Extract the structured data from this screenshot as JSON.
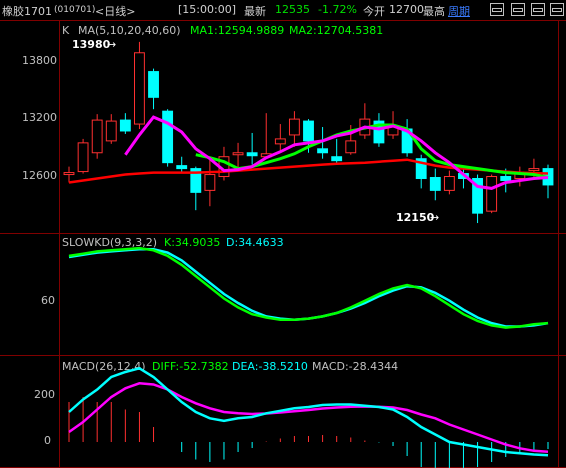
{
  "header": {
    "name": "橡胶1701",
    "code": "(010701)",
    "period": "<日线>",
    "time": "[15:00:00]",
    "latest_label": "最新",
    "latest": "12535",
    "change": "-1.72%",
    "open_label": "今开",
    "open": "12700",
    "high_label": "最高",
    "period_link": "周期"
  },
  "colors": {
    "up": "#ff3030",
    "down": "#00ffff",
    "ma1": "#ff00ff",
    "ma2": "#00ff00",
    "ma3": "#ff0000",
    "frame": "#800000",
    "text": "#c0c0c0"
  },
  "kline": {
    "legend_k": "K",
    "legend_ma": "MA(5,10,20,40,60)",
    "ma1_text": "MA1:12594.9889",
    "ma2_text": "MA2:12704.5381",
    "yticks": [
      "13800",
      "13200",
      "12600"
    ],
    "high_label": "13980",
    "low_label": "12150"
  },
  "slowkd": {
    "legend": "SLOWKD(9,3,3,2)",
    "k_text": "K:34.9035",
    "d_text": "D:34.4633",
    "yticks": [
      "60"
    ]
  },
  "macd": {
    "legend": "MACD(26,12,4)",
    "diff_text": "DIFF:-52.7382",
    "dea_text": "DEA:-38.5210",
    "macd_text": "MACD:-28.4344",
    "yticks": [
      "200",
      "0"
    ]
  },
  "chart_data": {
    "type": "candlestick",
    "candles": [
      {
        "o": 12640,
        "c": 12660,
        "h": 12720,
        "l": 12560
      },
      {
        "o": 12670,
        "c": 12960,
        "h": 13000,
        "l": 12650
      },
      {
        "o": 12860,
        "c": 13190,
        "h": 13250,
        "l": 12800
      },
      {
        "o": 12980,
        "c": 13180,
        "h": 13250,
        "l": 12950
      },
      {
        "o": 13190,
        "c": 13080,
        "h": 13260,
        "l": 13050
      },
      {
        "o": 13150,
        "c": 13870,
        "h": 13980,
        "l": 13100
      },
      {
        "o": 13680,
        "c": 13420,
        "h": 13710,
        "l": 13300
      },
      {
        "o": 13280,
        "c": 12760,
        "h": 13300,
        "l": 12720
      },
      {
        "o": 12730,
        "c": 12700,
        "h": 12820,
        "l": 12660
      },
      {
        "o": 12700,
        "c": 12460,
        "h": 12720,
        "l": 12280
      },
      {
        "o": 12480,
        "c": 12640,
        "h": 12800,
        "l": 12320
      },
      {
        "o": 12620,
        "c": 12820,
        "h": 12920,
        "l": 12580
      },
      {
        "o": 12840,
        "c": 12860,
        "h": 12960,
        "l": 12700
      },
      {
        "o": 12860,
        "c": 12830,
        "h": 13060,
        "l": 12740
      },
      {
        "o": 12820,
        "c": 12850,
        "h": 13260,
        "l": 12800
      },
      {
        "o": 12950,
        "c": 13000,
        "h": 13150,
        "l": 12880
      },
      {
        "o": 13040,
        "c": 13200,
        "h": 13280,
        "l": 12920
      },
      {
        "o": 13180,
        "c": 12980,
        "h": 13200,
        "l": 12860
      },
      {
        "o": 12900,
        "c": 12860,
        "h": 13120,
        "l": 12800
      },
      {
        "o": 12820,
        "c": 12780,
        "h": 13000,
        "l": 12740
      },
      {
        "o": 12860,
        "c": 12980,
        "h": 13140,
        "l": 12840
      },
      {
        "o": 13040,
        "c": 13200,
        "h": 13360,
        "l": 13000
      },
      {
        "o": 13180,
        "c": 12960,
        "h": 13260,
        "l": 12920
      },
      {
        "o": 13040,
        "c": 13120,
        "h": 13280,
        "l": 13000
      },
      {
        "o": 13100,
        "c": 12860,
        "h": 13200,
        "l": 12820
      },
      {
        "o": 12800,
        "c": 12600,
        "h": 12840,
        "l": 12500
      },
      {
        "o": 12610,
        "c": 12480,
        "h": 12700,
        "l": 12380
      },
      {
        "o": 12480,
        "c": 12620,
        "h": 12680,
        "l": 12440
      },
      {
        "o": 12650,
        "c": 12600,
        "h": 12720,
        "l": 12500
      },
      {
        "o": 12600,
        "c": 12250,
        "h": 12640,
        "l": 12150
      },
      {
        "o": 12270,
        "c": 12620,
        "h": 12640,
        "l": 12250
      },
      {
        "o": 12620,
        "c": 12580,
        "h": 12700,
        "l": 12460
      },
      {
        "o": 12600,
        "c": 12650,
        "h": 12720,
        "l": 12520
      },
      {
        "o": 12680,
        "c": 12700,
        "h": 12800,
        "l": 12600
      },
      {
        "o": 12700,
        "c": 12535,
        "h": 12740,
        "l": 12400
      }
    ],
    "kline_ylim": [
      12100,
      14100
    ],
    "ma5": [
      null,
      null,
      null,
      null,
      12840,
      13040,
      13220,
      13160,
      13070,
      12900,
      12800,
      12680,
      12690,
      12720,
      12810,
      12870,
      12940,
      12960,
      12980,
      13030,
      13060,
      13120,
      13100,
      13130,
      13080,
      12980,
      12860,
      12760,
      12640,
      12520,
      12500,
      12560,
      12580,
      12600,
      12610
    ],
    "ma10": [
      null,
      null,
      null,
      null,
      null,
      null,
      null,
      null,
      null,
      12840,
      12810,
      12770,
      12700,
      12720,
      12760,
      12800,
      12850,
      12920,
      12980,
      13040,
      13080,
      13110,
      13140,
      13140,
      13100,
      12900,
      12780,
      12740,
      12720,
      12700,
      12680,
      12660,
      12650,
      12640,
      12610
    ],
    "ma20": [
      12560,
      12580,
      12600,
      12620,
      12640,
      12650,
      12660,
      12660,
      12660,
      12660,
      12665,
      12670,
      12680,
      12690,
      12700,
      12710,
      12720,
      12730,
      12740,
      12750,
      12755,
      12760,
      12770,
      12780,
      12790,
      12760,
      12730,
      12710,
      12700,
      12690,
      12680,
      12670,
      12660,
      12655,
      12650
    ],
    "slowkd_ylim": [
      0,
      100
    ],
    "slowk": [
      84,
      86,
      88,
      89,
      90,
      91,
      89,
      84,
      76,
      66,
      56,
      46,
      38,
      32,
      29,
      27,
      27,
      28,
      30,
      33,
      38,
      44,
      50,
      55,
      58,
      55,
      48,
      40,
      32,
      26,
      22,
      20,
      21,
      23,
      24
    ],
    "slowd": [
      83,
      85,
      87,
      88,
      89,
      90,
      90,
      87,
      80,
      70,
      60,
      50,
      42,
      35,
      30,
      28,
      27,
      28,
      30,
      33,
      37,
      42,
      48,
      53,
      57,
      56,
      51,
      44,
      36,
      29,
      24,
      21,
      21,
      22,
      24
    ],
    "macd_ylim": [
      -80,
      320
    ],
    "diff": [
      120,
      170,
      210,
      260,
      280,
      295,
      260,
      210,
      160,
      120,
      95,
      85,
      95,
      100,
      115,
      125,
      135,
      140,
      148,
      150,
      150,
      145,
      140,
      130,
      100,
      60,
      30,
      0,
      -10,
      -20,
      -30,
      -40,
      -45,
      -50,
      -53
    ],
    "dea": [
      40,
      80,
      130,
      180,
      215,
      235,
      230,
      210,
      180,
      155,
      135,
      120,
      115,
      112,
      114,
      118,
      123,
      128,
      134,
      138,
      141,
      142,
      141,
      138,
      128,
      110,
      95,
      70,
      50,
      30,
      10,
      -10,
      -25,
      -35,
      -39
    ],
    "macd_bar": [
      160,
      180,
      160,
      160,
      130,
      120,
      60,
      0,
      -40,
      -70,
      -80,
      -70,
      -40,
      -24,
      2,
      14,
      24,
      24,
      28,
      24,
      18,
      6,
      -2,
      -16,
      -56,
      -100,
      -130,
      -140,
      -120,
      -100,
      -80,
      -60,
      -40,
      -30,
      -28
    ]
  }
}
